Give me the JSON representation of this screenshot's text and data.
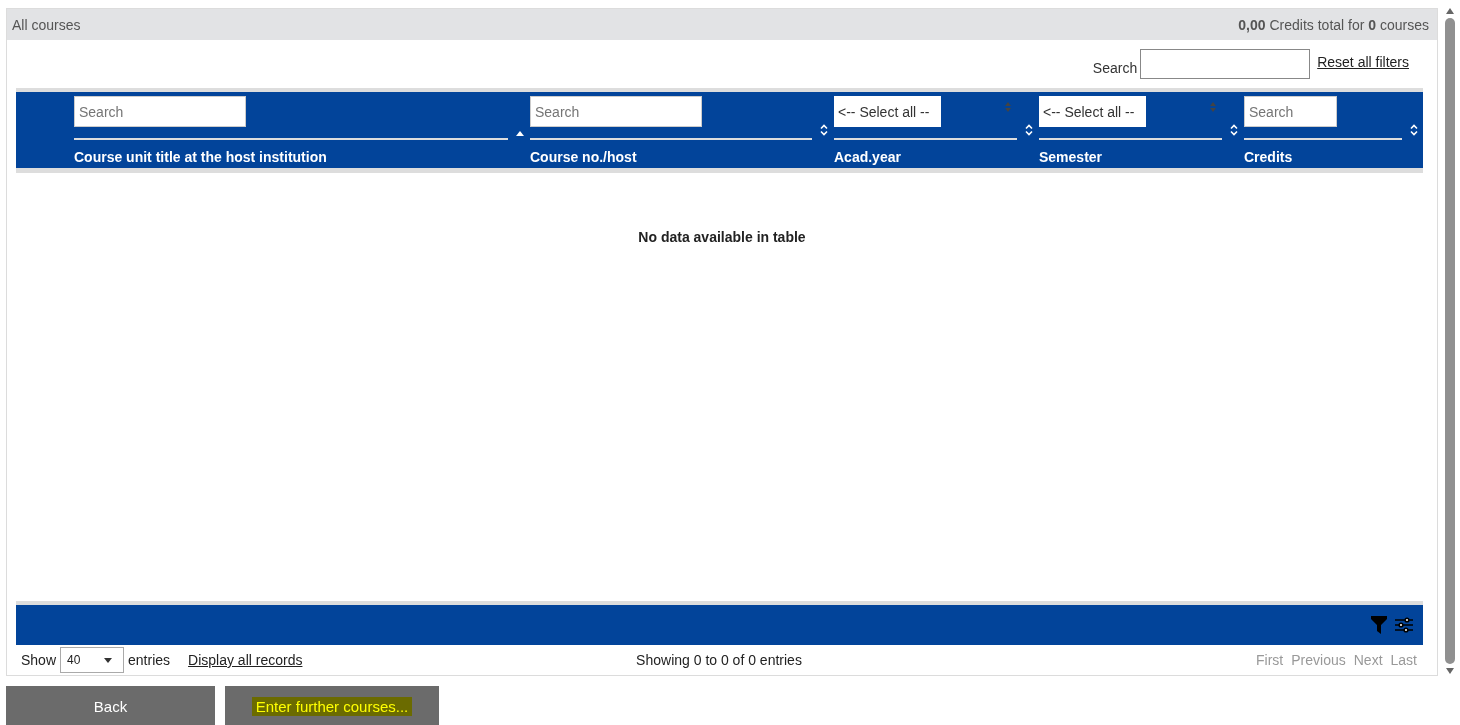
{
  "panel": {
    "title": "All courses",
    "summary": "**0,00** Credits total for **0** courses"
  },
  "toolbar": {
    "search_label": "Search",
    "reset_link": "Reset all filters"
  },
  "table": {
    "columns": [
      {
        "title": "Course unit title at the host institution",
        "filter": {
          "kind": "text",
          "placeholder": "Search"
        },
        "sorted": true
      },
      {
        "title": "Course no./host",
        "filter": {
          "kind": "text",
          "placeholder": "Search"
        },
        "sorted": false
      },
      {
        "title": "Acad.year",
        "filter": {
          "kind": "select",
          "value": "<-- Select all --"
        },
        "sorted": false
      },
      {
        "title": "Semester",
        "filter": {
          "kind": "select",
          "value": "<-- Select all --"
        },
        "sorted": false
      },
      {
        "title": "Credits",
        "filter": {
          "kind": "text",
          "placeholder": "Search"
        },
        "sorted": false
      }
    ],
    "empty_message": "No data available in table"
  },
  "length_menu": {
    "show_label": "Show",
    "value": "40",
    "entries_label": "entries"
  },
  "display_all_link": "Display all records",
  "info": "Showing 0 to 0 of 0 entries",
  "pagination": [
    {
      "label": "First",
      "disabled": true
    },
    {
      "label": "Previous",
      "disabled": true
    },
    {
      "label": "Next",
      "disabled": true
    },
    {
      "label": "Last",
      "disabled": true
    }
  ],
  "buttons": [
    {
      "label": "Back",
      "highlighted": false
    },
    {
      "label": "Enter further courses...",
      "highlighted": true
    }
  ]
}
